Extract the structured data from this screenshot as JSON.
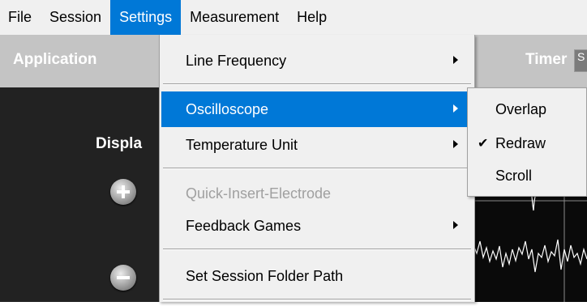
{
  "menubar": {
    "items": [
      "File",
      "Session",
      "Settings",
      "Measurement",
      "Help"
    ],
    "active_index": 2
  },
  "app": {
    "title": "Application",
    "timer_label": "Timer",
    "timer_value": "S"
  },
  "panel": {
    "display_label": "Displa"
  },
  "settings_menu": {
    "items": [
      {
        "label": "Line Frequency",
        "has_submenu": true,
        "enabled": true
      },
      {
        "label": "Oscilloscope",
        "has_submenu": true,
        "enabled": true,
        "highlighted": true
      },
      {
        "label": "Temperature Unit",
        "has_submenu": true,
        "enabled": true
      },
      {
        "label": "Quick-Insert-Electrode",
        "has_submenu": false,
        "enabled": false
      },
      {
        "label": "Feedback Games",
        "has_submenu": true,
        "enabled": true
      },
      {
        "label": "Set Session Folder Path",
        "has_submenu": false,
        "enabled": true
      }
    ]
  },
  "oscilloscope_submenu": {
    "items": [
      {
        "label": "Overlap",
        "checked": false
      },
      {
        "label": "Redraw",
        "checked": true
      },
      {
        "label": "Scroll",
        "checked": false
      }
    ],
    "check_glyph": "✔"
  },
  "colors": {
    "highlight": "#0078d7",
    "menu_bg": "#f0f0f0",
    "app_bar": "#c4c4c4",
    "dark_panel": "#222222"
  }
}
